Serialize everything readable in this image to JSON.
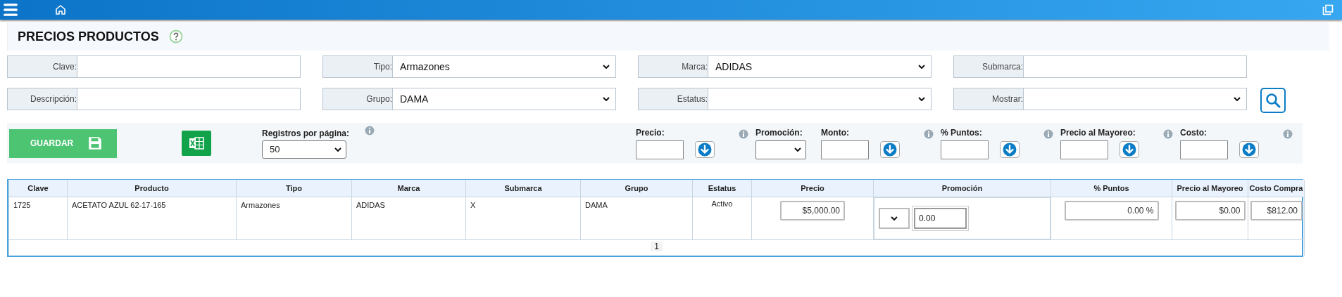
{
  "title": "PRECIOS PRODUCTOS",
  "filters": [
    {
      "label": "Clave:",
      "kind": "text"
    },
    {
      "label": "Tipo:",
      "kind": "select",
      "value": "Armazones"
    },
    {
      "label": "Marca:",
      "kind": "select",
      "value": "ADIDAS"
    },
    {
      "label": "Submarca:",
      "kind": "text"
    },
    {
      "label": "Descripción:",
      "kind": "text"
    },
    {
      "label": "Grupo:",
      "kind": "select",
      "value": "DAMA"
    },
    {
      "label": "Estatus:",
      "kind": "select"
    },
    {
      "label": "Mostrar:",
      "kind": "select"
    }
  ],
  "save_button": "GUARDAR",
  "page_size": {
    "label": "Registros por página:",
    "value": "50"
  },
  "bulk_fields": [
    {
      "label": "Precio:",
      "kind": "input"
    },
    {
      "label": "Promoción:",
      "kind": "select"
    },
    {
      "label": "Monto:",
      "kind": "input"
    },
    {
      "label": "% Puntos:",
      "kind": "input"
    },
    {
      "label": "Precio al Mayoreo:",
      "kind": "input"
    },
    {
      "label": "Costo:",
      "kind": "input"
    }
  ],
  "table": {
    "columns": [
      "Clave",
      "Producto",
      "Tipo",
      "Marca",
      "Submarca",
      "Grupo",
      "Estatus",
      "Precio",
      "Promoción",
      "% Puntos",
      "Precio al Mayoreo",
      "Costo Compra"
    ],
    "rows": [
      {
        "cells": [
          {
            "kind": "text",
            "value": "1725"
          },
          {
            "kind": "text",
            "value": "ACETATO AZUL 62-17-165"
          },
          {
            "kind": "text",
            "value": "Armazones"
          },
          {
            "kind": "text",
            "value": "ADIDAS"
          },
          {
            "kind": "text",
            "value": "X"
          },
          {
            "kind": "text",
            "value": "DAMA"
          },
          {
            "kind": "center",
            "value": "Activo"
          },
          {
            "kind": "input",
            "value": "$5,000.00"
          },
          {
            "kind": "promo",
            "value": "0.00"
          },
          {
            "kind": "input",
            "value": "0.00 %"
          },
          {
            "kind": "input",
            "value": "$0.00"
          },
          {
            "kind": "input",
            "value": "$812.00"
          }
        ]
      }
    ],
    "pages": [
      {
        "label": "1",
        "selected": true
      }
    ]
  }
}
